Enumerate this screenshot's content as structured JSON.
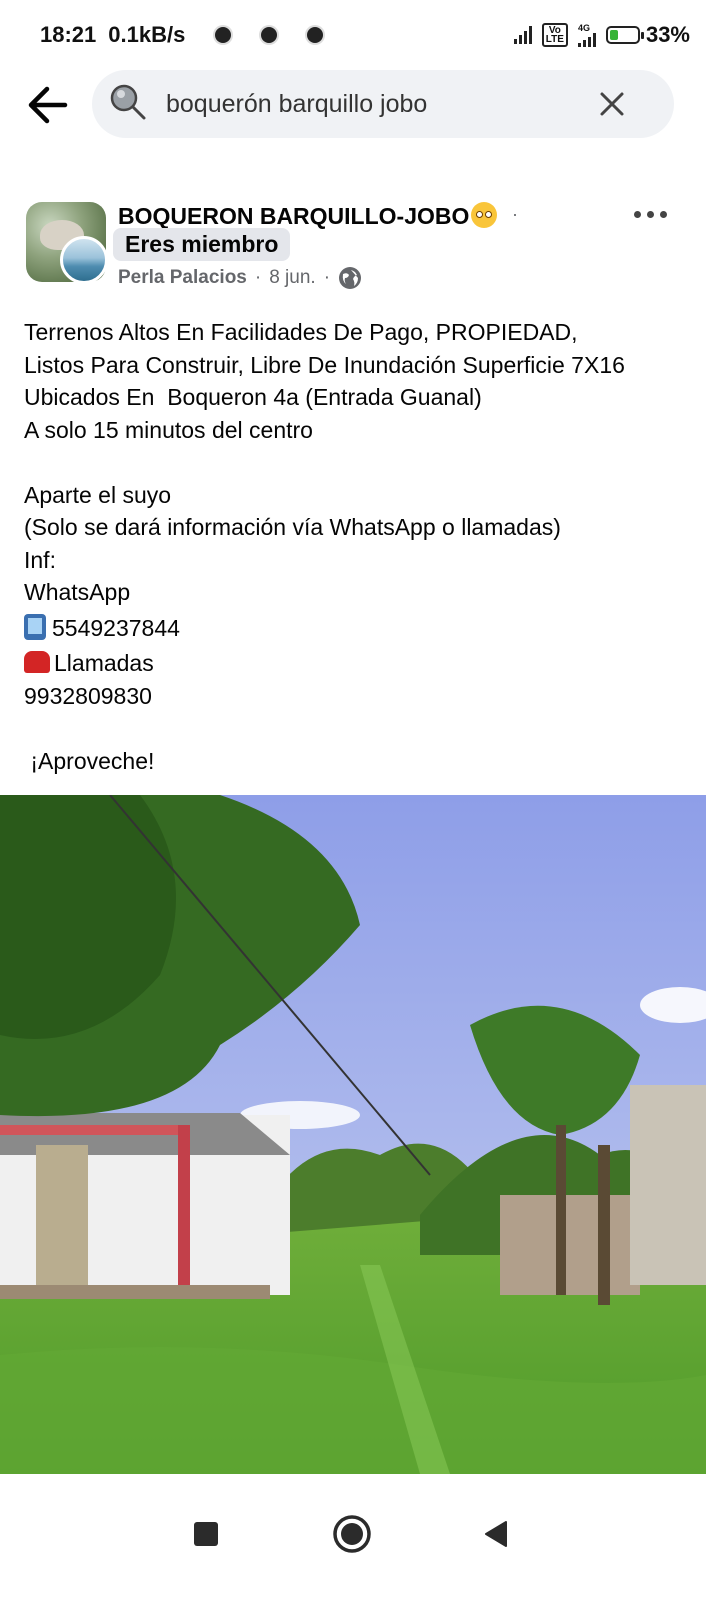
{
  "status_bar": {
    "time": "18:21",
    "speed": "0.1kB/s",
    "network": "4G",
    "battery_percent": "33%",
    "battery_level": 0.33
  },
  "search": {
    "query": "boquerón barquillo jobo"
  },
  "post": {
    "group_name": "BOQUERON BARQUILLO-JOBO",
    "group_separator": "·",
    "member_badge": "Eres miembro",
    "author": "Perla Palacios",
    "date": "8 jun.",
    "lines": [
      "Terrenos Altos En Facilidades De Pago, PROPIEDAD,",
      "Listos Para Construir, Libre De Inundación Superficie 7X16",
      "Ubicados En  Boqueron 4a (Entrada Guanal)",
      "A solo 15 minutos del centro",
      "",
      "Aparte el suyo",
      "(Solo se dará información vía WhatsApp o llamadas)",
      "Inf:",
      "WhatsApp"
    ],
    "whatsapp_number": "5549237844",
    "calls_label": "Llamadas",
    "calls_number": "9932809830",
    "closing": " ¡Aproveche!"
  },
  "colors": {
    "accent": "#1877f2",
    "badge_bg": "#e4e6eb",
    "muted_text": "#65676b",
    "search_bg": "#f0f2f5"
  },
  "icons": {
    "back": "back-arrow-icon",
    "search": "search-icon",
    "clear": "close-icon",
    "more": "more-options-icon",
    "privacy": "globe-icon",
    "nav_recents": "square-icon",
    "nav_home": "circle-icon",
    "nav_back": "triangle-back-icon"
  }
}
